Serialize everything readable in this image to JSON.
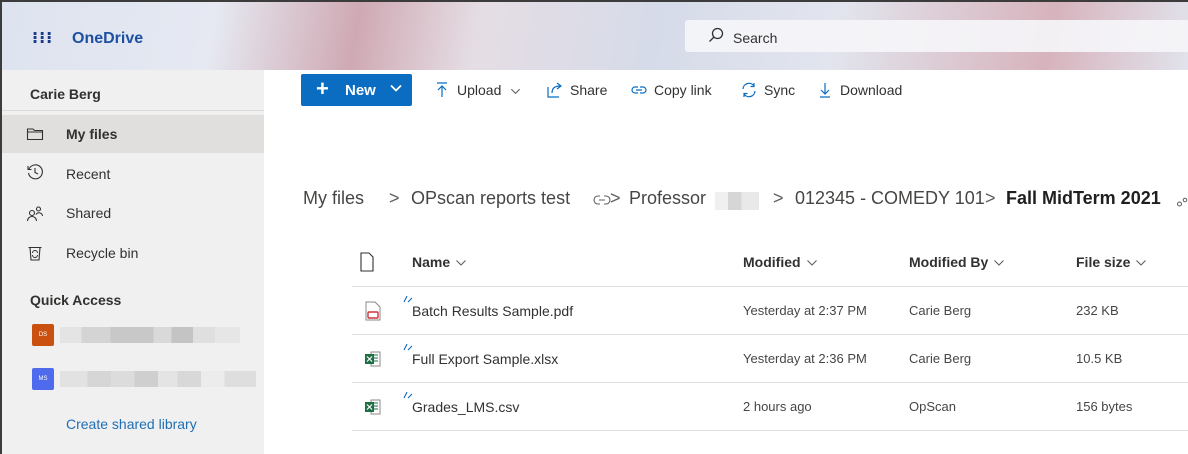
{
  "app": {
    "name": "OneDrive"
  },
  "search": {
    "label": "Search"
  },
  "sidebar": {
    "user": "Carie Berg",
    "items": [
      {
        "label": "My files",
        "icon": "folder-icon",
        "active": true
      },
      {
        "label": "Recent",
        "icon": "clock-icon",
        "active": false
      },
      {
        "label": "Shared",
        "icon": "people-icon",
        "active": false
      },
      {
        "label": "Recycle bin",
        "icon": "recycle-bin-icon",
        "active": false
      }
    ],
    "quick_access_title": "Quick Access",
    "quick_access": [
      {
        "badge": "DS",
        "color": "#ca5010"
      },
      {
        "badge": "MS",
        "color": "#4f6bed"
      }
    ],
    "create_library": "Create shared library"
  },
  "toolbar": {
    "new_label": "New",
    "upload_label": "Upload",
    "share_label": "Share",
    "copy_link_label": "Copy link",
    "sync_label": "Sync",
    "download_label": "Download"
  },
  "breadcrumb": [
    "My files",
    "OPscan reports test",
    "Professor",
    "012345 - COMEDY 101",
    "Fall MidTerm 2021"
  ],
  "table": {
    "columns": {
      "name": "Name",
      "modified": "Modified",
      "modified_by": "Modified By",
      "file_size": "File size"
    },
    "rows": [
      {
        "name": "Batch Results Sample.pdf",
        "modified": "Yesterday at 2:37 PM",
        "modified_by": "Carie Berg",
        "file_size": "232 KB",
        "icon": "pdf-file-icon"
      },
      {
        "name": "Full Export Sample.xlsx",
        "modified": "Yesterday at 2:36 PM",
        "modified_by": "Carie Berg",
        "file_size": "10.5 KB",
        "icon": "excel-file-icon"
      },
      {
        "name": "Grades_LMS.csv",
        "modified": "2 hours ago",
        "modified_by": "OpScan",
        "file_size": "156 bytes",
        "icon": "excel-file-icon"
      }
    ]
  },
  "colors": {
    "accent": "#0a6dc2",
    "brand": "#1d50a3",
    "sidebar": "#f0f0f0",
    "excel": "#1d7044",
    "pdf": "#d13438"
  }
}
